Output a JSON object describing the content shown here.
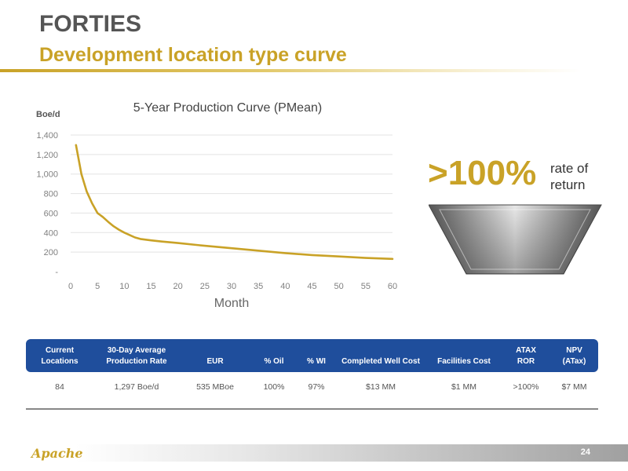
{
  "header": {
    "title": "FORTIES",
    "subtitle": "Development location type curve"
  },
  "callout": {
    "value": ">100%",
    "text_line1": "rate of",
    "text_line2": "return"
  },
  "chart_data": {
    "type": "line",
    "title": "5-Year Production Curve (PMean)",
    "xlabel": "Month",
    "ylabel": "Boe/d",
    "xlim": [
      0,
      60
    ],
    "ylim": [
      0,
      1400
    ],
    "x_ticks": [
      "0",
      "5",
      "10",
      "15",
      "20",
      "25",
      "30",
      "35",
      "40",
      "45",
      "50",
      "55",
      "60"
    ],
    "y_ticks": [
      "-",
      "200",
      "400",
      "600",
      "800",
      "1,000",
      "1,200",
      "1,400"
    ],
    "grid": true,
    "series": [
      {
        "color": "#c9a227",
        "x": [
          1,
          2,
          3,
          4,
          5,
          6,
          7,
          8,
          9,
          10,
          11,
          12,
          13,
          15,
          17,
          20,
          25,
          30,
          35,
          40,
          45,
          50,
          55,
          60
        ],
        "y": [
          1297,
          1000,
          820,
          700,
          600,
          560,
          510,
          465,
          430,
          400,
          375,
          350,
          335,
          320,
          308,
          293,
          265,
          240,
          215,
          190,
          170,
          155,
          140,
          130
        ]
      }
    ]
  },
  "table": {
    "headers": [
      [
        "Current",
        "Locations"
      ],
      [
        "30-Day Average",
        "Production Rate"
      ],
      [
        "",
        "EUR"
      ],
      [
        "",
        "% Oil"
      ],
      [
        "",
        "% WI"
      ],
      [
        "",
        "Completed Well Cost"
      ],
      [
        "",
        "Facilities Cost"
      ],
      [
        "ATAX",
        "ROR"
      ],
      [
        "NPV",
        "(ATax)"
      ]
    ],
    "row": [
      "84",
      "1,297 Boe/d",
      "535 MBoe",
      "100%",
      "97%",
      "$13 MM",
      "$1 MM",
      ">100%",
      "$7 MM"
    ]
  },
  "footer": {
    "logo_text": "Apache",
    "page_number": "24"
  },
  "colors": {
    "accent_gold": "#c9a227",
    "title_gray": "#555555",
    "table_header_blue": "#1f4e9c"
  }
}
